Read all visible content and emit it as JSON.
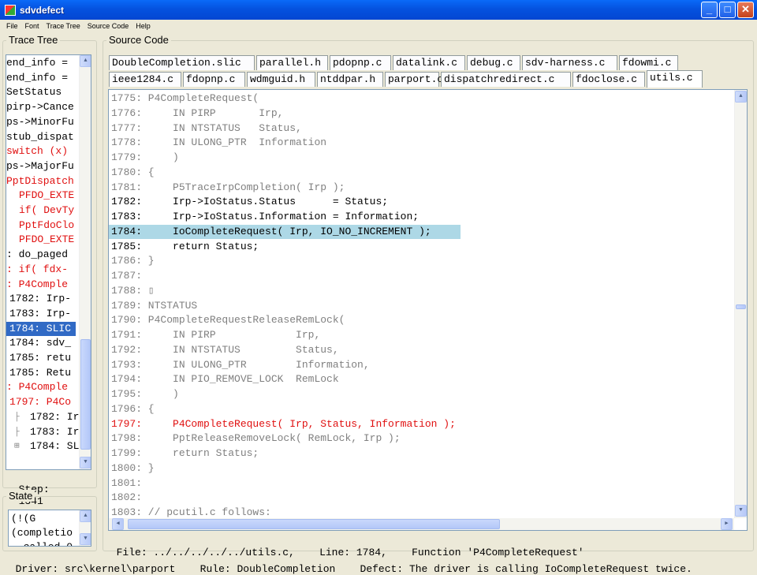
{
  "window": {
    "title": "sdvdefect",
    "minimize": "_",
    "maximize": "□",
    "close": "✕"
  },
  "menu": [
    "File",
    "Font",
    "Trace Tree",
    "Source Code",
    "Help"
  ],
  "trace_tree": {
    "label": "Trace Tree",
    "rows": [
      {
        "text": "end_info =",
        "indent": 0,
        "color": "black"
      },
      {
        "text": "end_info =",
        "indent": 0,
        "color": "black"
      },
      {
        "text": "SetStatus",
        "indent": 0,
        "color": "black"
      },
      {
        "text": "pirp->Cance",
        "indent": 0,
        "color": "black"
      },
      {
        "text": "ps->MinorFu",
        "indent": 0,
        "color": "black"
      },
      {
        "text": "stub_dispat",
        "indent": 0,
        "color": "black"
      },
      {
        "text": "switch (x)",
        "indent": 0,
        "color": "red"
      },
      {
        "text": "ps->MajorFu",
        "indent": 0,
        "color": "black"
      },
      {
        "text": "PptDispatch",
        "indent": 0,
        "color": "red"
      },
      {
        "text": "PFDO_EXTE",
        "indent": 16,
        "color": "red"
      },
      {
        "text": "if( DevTy",
        "indent": 16,
        "color": "red"
      },
      {
        "text": "PptFdoClo",
        "indent": 16,
        "color": "red"
      },
      {
        "text": "PFDO_EXTE",
        "indent": 16,
        "color": "red"
      },
      {
        "text": ": do_paged",
        "indent": 0,
        "color": "black"
      },
      {
        "text": ": if( fdx-",
        "indent": 0,
        "color": "red"
      },
      {
        "text": ": P4Comple",
        "indent": 0,
        "color": "red"
      },
      {
        "text": "1782: Irp-",
        "indent": 4,
        "color": "black"
      },
      {
        "text": "1783: Irp-",
        "indent": 4,
        "color": "black"
      },
      {
        "text": "1784: SLIC",
        "indent": 4,
        "color": "black",
        "selected": true
      },
      {
        "text": "1784: sdv_",
        "indent": 4,
        "color": "black"
      },
      {
        "text": "1785: retu",
        "indent": 4,
        "color": "black"
      },
      {
        "text": "1785: Retu",
        "indent": 4,
        "color": "black"
      },
      {
        "text": ": P4Comple",
        "indent": 0,
        "color": "red"
      },
      {
        "text": "1797: P4Co",
        "indent": 4,
        "color": "red"
      },
      {
        "text": "1782: Ir",
        "indent": 30,
        "color": "black",
        "tree": "├"
      },
      {
        "text": "1783: Ir",
        "indent": 30,
        "color": "black",
        "tree": "├"
      },
      {
        "text": "1784: SL",
        "indent": 30,
        "color": "black",
        "tree": "⊞"
      }
    ]
  },
  "step": {
    "label": "Step:",
    "value": "1341"
  },
  "state": {
    "label": "State",
    "lines": [
      "(!(G",
      "(completio",
      "__called 0"
    ]
  },
  "source": {
    "label": "Source Code",
    "tabs_row1": [
      "DoubleCompletion.slic",
      "parallel.h",
      "pdopnp.c",
      "datalink.c",
      "debug.c",
      "sdv-harness.c",
      "fdowmi.c"
    ],
    "tabs_row2": [
      "ieee1284.c",
      "fdopnp.c",
      "wdmguid.h",
      "ntddpar.h",
      "parport.c",
      "dispatchredirect.c",
      "fdoclose.c",
      "utils.c"
    ],
    "active_tab": "utils.c",
    "lines": [
      {
        "text": "1775: P4CompleteRequest(",
        "style": "gray"
      },
      {
        "text": "1776:     IN PIRP       Irp,",
        "style": "gray"
      },
      {
        "text": "1777:     IN NTSTATUS   Status,",
        "style": "gray"
      },
      {
        "text": "1778:     IN ULONG_PTR  Information",
        "style": "gray"
      },
      {
        "text": "1779:     )",
        "style": "gray"
      },
      {
        "text": "1780: {",
        "style": "gray"
      },
      {
        "text": "1781:     P5TraceIrpCompletion( Irp );",
        "style": "gray"
      },
      {
        "text": "1782:     Irp->IoStatus.Status      = Status;",
        "style": "black"
      },
      {
        "text": "1783:     Irp->IoStatus.Information = Information;",
        "style": "black"
      },
      {
        "text": "1784:     IoCompleteRequest( Irp, IO_NO_INCREMENT );",
        "style": "highlight"
      },
      {
        "text": "1785:     return Status;",
        "style": "black"
      },
      {
        "text": "1786: }",
        "style": "gray"
      },
      {
        "text": "1787:",
        "style": "gray"
      },
      {
        "text": "1788: ▯",
        "style": "gray"
      },
      {
        "text": "1789: NTSTATUS",
        "style": "gray"
      },
      {
        "text": "1790: P4CompleteRequestReleaseRemLock(",
        "style": "gray"
      },
      {
        "text": "1791:     IN PIRP             Irp,",
        "style": "gray"
      },
      {
        "text": "1792:     IN NTSTATUS         Status,",
        "style": "gray"
      },
      {
        "text": "1793:     IN ULONG_PTR        Information,",
        "style": "gray"
      },
      {
        "text": "1794:     IN PIO_REMOVE_LOCK  RemLock",
        "style": "gray"
      },
      {
        "text": "1795:     )",
        "style": "gray"
      },
      {
        "text": "1796: {",
        "style": "gray"
      },
      {
        "text": "1797:     P4CompleteRequest( Irp, Status, Information );",
        "style": "red"
      },
      {
        "text": "1798:     PptReleaseRemoveLock( RemLock, Irp );",
        "style": "gray"
      },
      {
        "text": "1799:     return Status;",
        "style": "gray"
      },
      {
        "text": "1800: }",
        "style": "gray"
      },
      {
        "text": "1801:",
        "style": "gray"
      },
      {
        "text": "1802:",
        "style": "gray"
      },
      {
        "text": "1803: // pcutil.c follows:",
        "style": "gray"
      }
    ]
  },
  "file_status": {
    "file": "File: ../../../../../utils.c,",
    "line": "Line: 1784,",
    "function": "Function 'P4CompleteRequest'"
  },
  "bottom_status": {
    "driver": "Driver: src\\kernel\\parport",
    "rule": "Rule: DoubleCompletion",
    "defect": "Defect: The driver is calling IoCompleteRequest twice."
  },
  "colors": {
    "highlight": "#add8e6",
    "selection": "#316ac5",
    "error_red": "#e01010",
    "titlebar": "#0552df"
  }
}
